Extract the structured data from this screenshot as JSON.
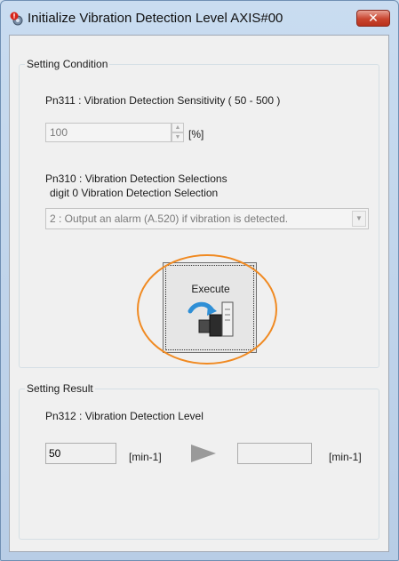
{
  "window": {
    "title": "Initialize Vibration Detection Level AXIS#00",
    "close_glyph": "✕"
  },
  "setting_condition": {
    "title": "Setting Condition",
    "sensitivity_label": "Pn311 : Vibration Detection Sensitivity  ( 50 - 500 )",
    "sensitivity_value": "100",
    "sensitivity_unit": "[%]",
    "selections_label": "Pn310 : Vibration Detection Selections",
    "selection_digit_label": "digit 0 Vibration Detection Selection",
    "selection_value": "2 : Output an alarm (A.520) if vibration is detected.",
    "execute_label": "Execute"
  },
  "setting_result": {
    "title": "Setting Result",
    "level_label": "Pn312 : Vibration Detection Level",
    "current_value": "50",
    "current_unit": "[min-1]",
    "new_value": "",
    "new_unit": "[min-1]"
  },
  "colors": {
    "highlight_ring": "#f08a22",
    "close_button": "#c9452f",
    "arrow_icon": "#9a9a9a"
  },
  "icons": {
    "app": "warning-gear-icon",
    "execute": "motor-arrow-icon",
    "transfer": "play-arrow-icon"
  }
}
